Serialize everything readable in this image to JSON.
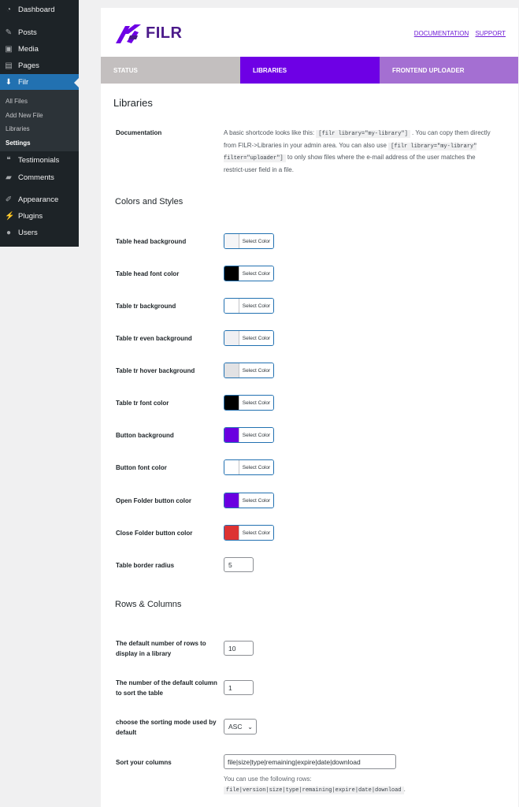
{
  "sidebar": {
    "items": [
      {
        "label": "Dashboard",
        "icon": "dashboard-icon"
      },
      {
        "label": "Posts",
        "icon": "pin-icon"
      },
      {
        "label": "Media",
        "icon": "media-icon"
      },
      {
        "label": "Pages",
        "icon": "pages-icon"
      },
      {
        "label": "Filr",
        "icon": "download-icon"
      },
      {
        "label": "Testimonials",
        "icon": "testimonial-icon"
      },
      {
        "label": "Comments",
        "icon": "comment-icon"
      },
      {
        "label": "Appearance",
        "icon": "brush-icon"
      },
      {
        "label": "Plugins",
        "icon": "plugin-icon"
      },
      {
        "label": "Users",
        "icon": "user-icon"
      }
    ],
    "submenu": [
      "All Files",
      "Add New File",
      "Libraries",
      "Settings"
    ]
  },
  "header": {
    "logo_text": "FILR",
    "links": [
      "DOCUMENTATION",
      "SUPPORT"
    ]
  },
  "tabs": [
    "STATUS",
    "LIBRARIES",
    "FRONTEND UPLOADER"
  ],
  "page": {
    "heading": "Libraries",
    "documentation": {
      "label": "Documentation",
      "text1": "A basic shortcode looks like this: ",
      "code1": "[filr library=\"my-library\"]",
      "text2": " . You can copy them directly from FILR->Libraries in your admin area. You can also use ",
      "code2": "[filr library=\"my-library\" filter=\"uploader\"]",
      "text3": " to only show files where the e-mail address of the user matches the restrict-user field in a file."
    }
  },
  "sections": {
    "colors": "Colors and Styles",
    "rows": "Rows & Columns"
  },
  "color_button_label": "Select Color",
  "color_fields": [
    {
      "label": "Table head background",
      "color": "#f5f5f7"
    },
    {
      "label": "Table head font color",
      "color": "#000000"
    },
    {
      "label": "Table tr background",
      "color": "#ffffff"
    },
    {
      "label": "Table tr even background",
      "color": "#f0f0f3"
    },
    {
      "label": "Table tr hover background",
      "color": "#e2e2e4"
    },
    {
      "label": "Table tr font color",
      "color": "#000000"
    },
    {
      "label": "Button background",
      "color": "#6a00e0"
    },
    {
      "label": "Button font color",
      "color": "#ffffff"
    },
    {
      "label": "Open Folder button color",
      "color": "#6a00e0"
    },
    {
      "label": "Close Folder button color",
      "color": "#dd3333"
    }
  ],
  "border_radius": {
    "label": "Table border radius",
    "value": "5"
  },
  "rows_fields": {
    "default_rows": {
      "label": "The default number of rows to display in a library",
      "value": "10"
    },
    "sort_column": {
      "label": "The number of the default column to sort the table",
      "value": "1"
    },
    "sort_mode": {
      "label": "choose the sorting mode used by default",
      "value": "ASC"
    },
    "sort_columns": {
      "label": "Sort your columns",
      "value": "file|size|type|remaining|expire|date|download",
      "hint": "You can use the following rows:",
      "hint_code": "file|version|size|type|remaining|expire|date|download",
      "hint_end": "."
    }
  },
  "colors": {
    "sidebar_bg": "#1d2327",
    "active": "#2271b1",
    "brand": "#6e00e5",
    "link": "#6f1cd6"
  }
}
